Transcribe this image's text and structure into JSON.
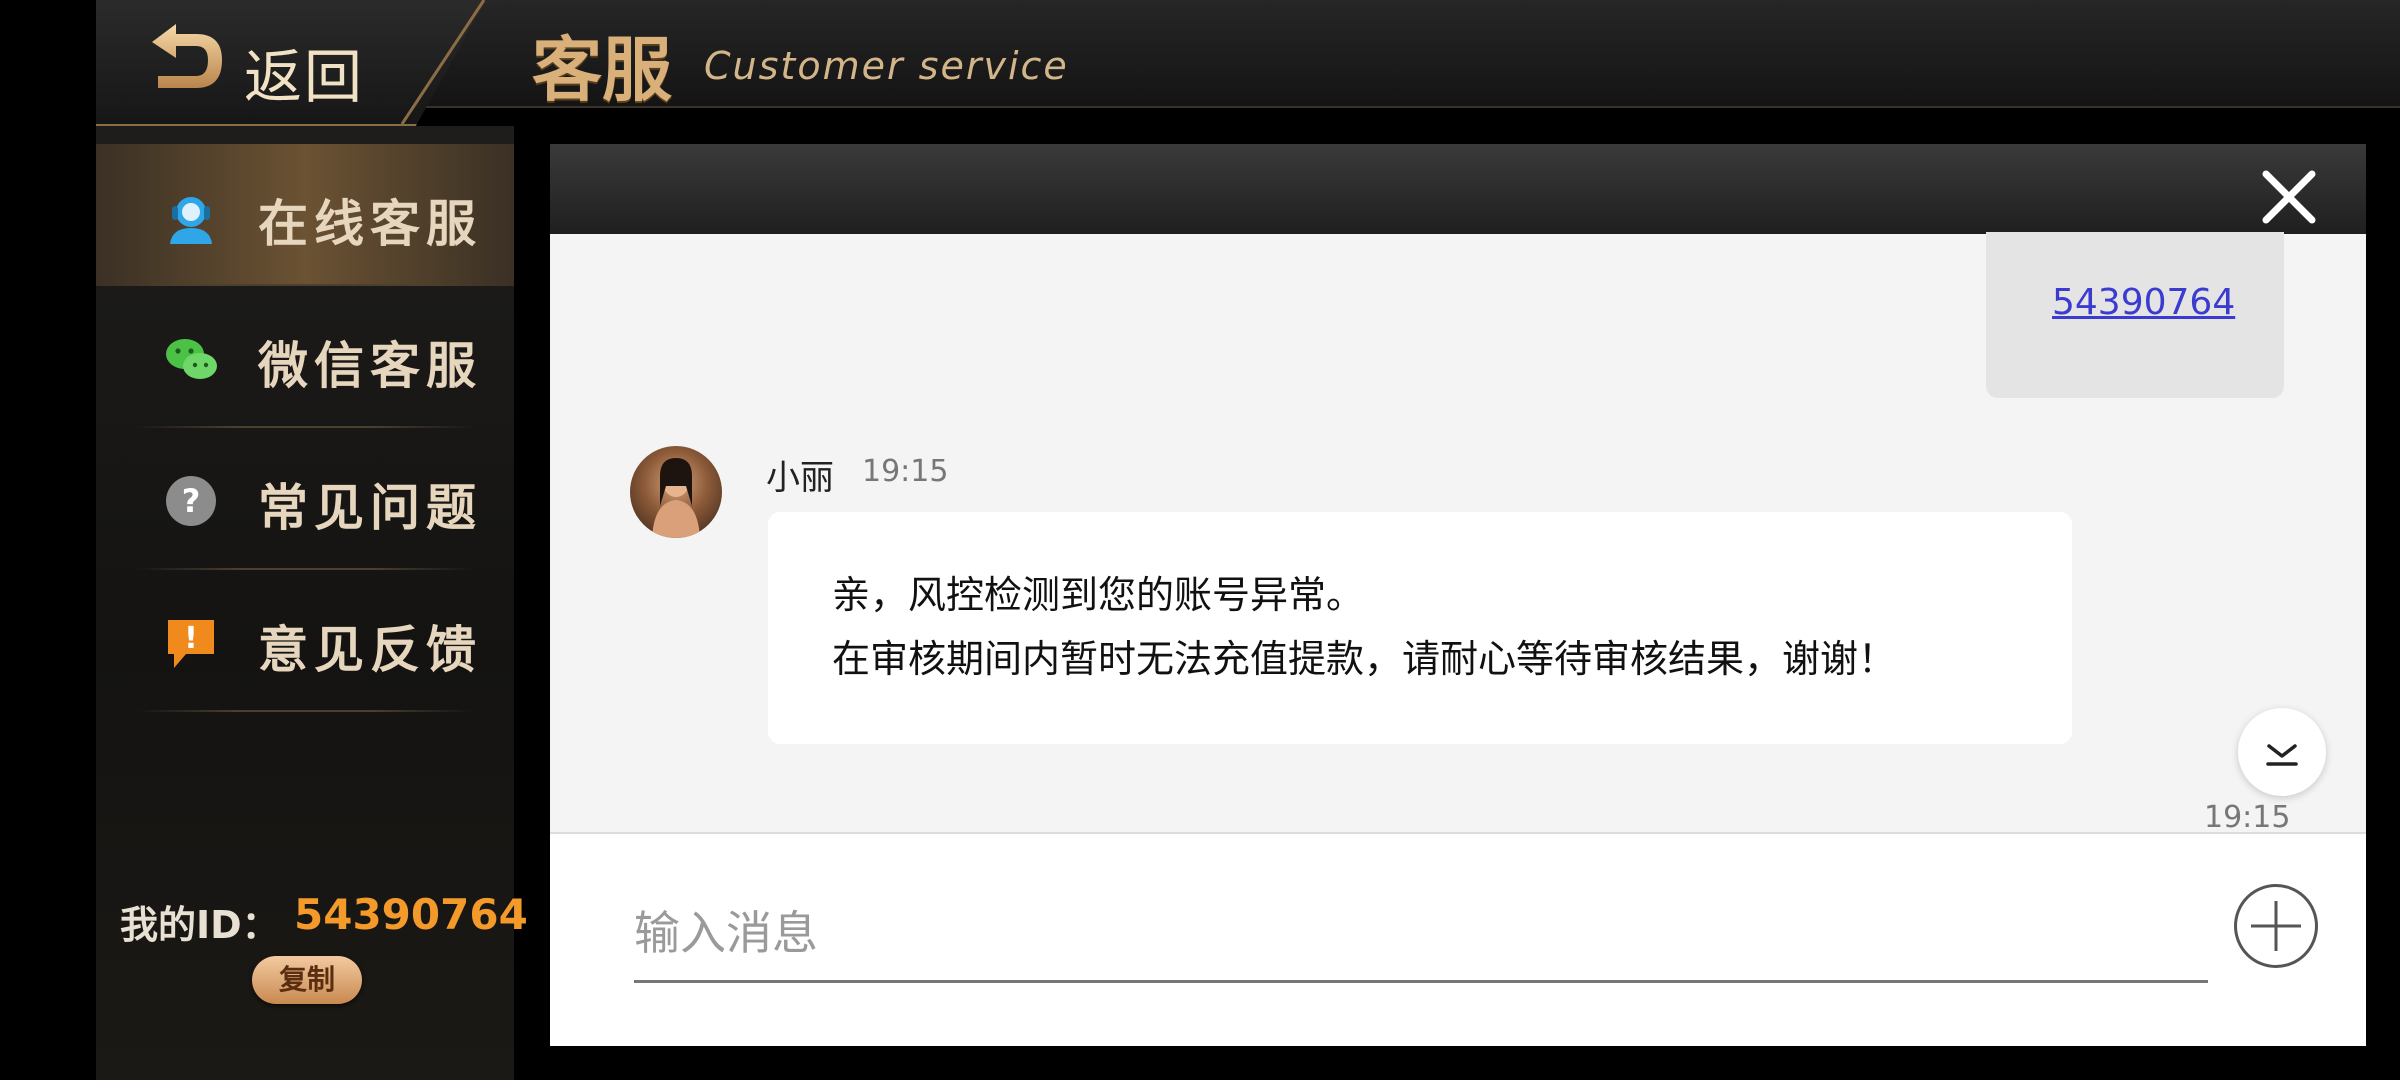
{
  "header": {
    "back_label": "返回",
    "title": "客服",
    "subtitle": "Customer service"
  },
  "sidebar": {
    "items": [
      {
        "label": "在线客服",
        "icon": "headset-icon",
        "active": true
      },
      {
        "label": "微信客服",
        "icon": "wechat-icon",
        "active": false
      },
      {
        "label": "常见问题",
        "icon": "question-icon",
        "active": false
      },
      {
        "label": "意见反馈",
        "icon": "feedback-icon",
        "active": false
      }
    ],
    "my_id_label": "我的ID：",
    "my_id_value": "54390764",
    "copy_label": "复制"
  },
  "chat": {
    "my_message": "54390764",
    "agent_name": "小丽",
    "agent_time": "19:15",
    "agent_message_line1": "亲，风控检测到您的账号异常。",
    "agent_message_line2": "在审核期间内暂时无法充值提款，请耐心等待审核结果，谢谢！",
    "bottom_time": "19:15",
    "input_placeholder": "输入消息"
  },
  "colors": {
    "accent_gold": "#d9b07a",
    "id_orange": "#f39a2b",
    "link_blue": "#3b3bd0"
  }
}
